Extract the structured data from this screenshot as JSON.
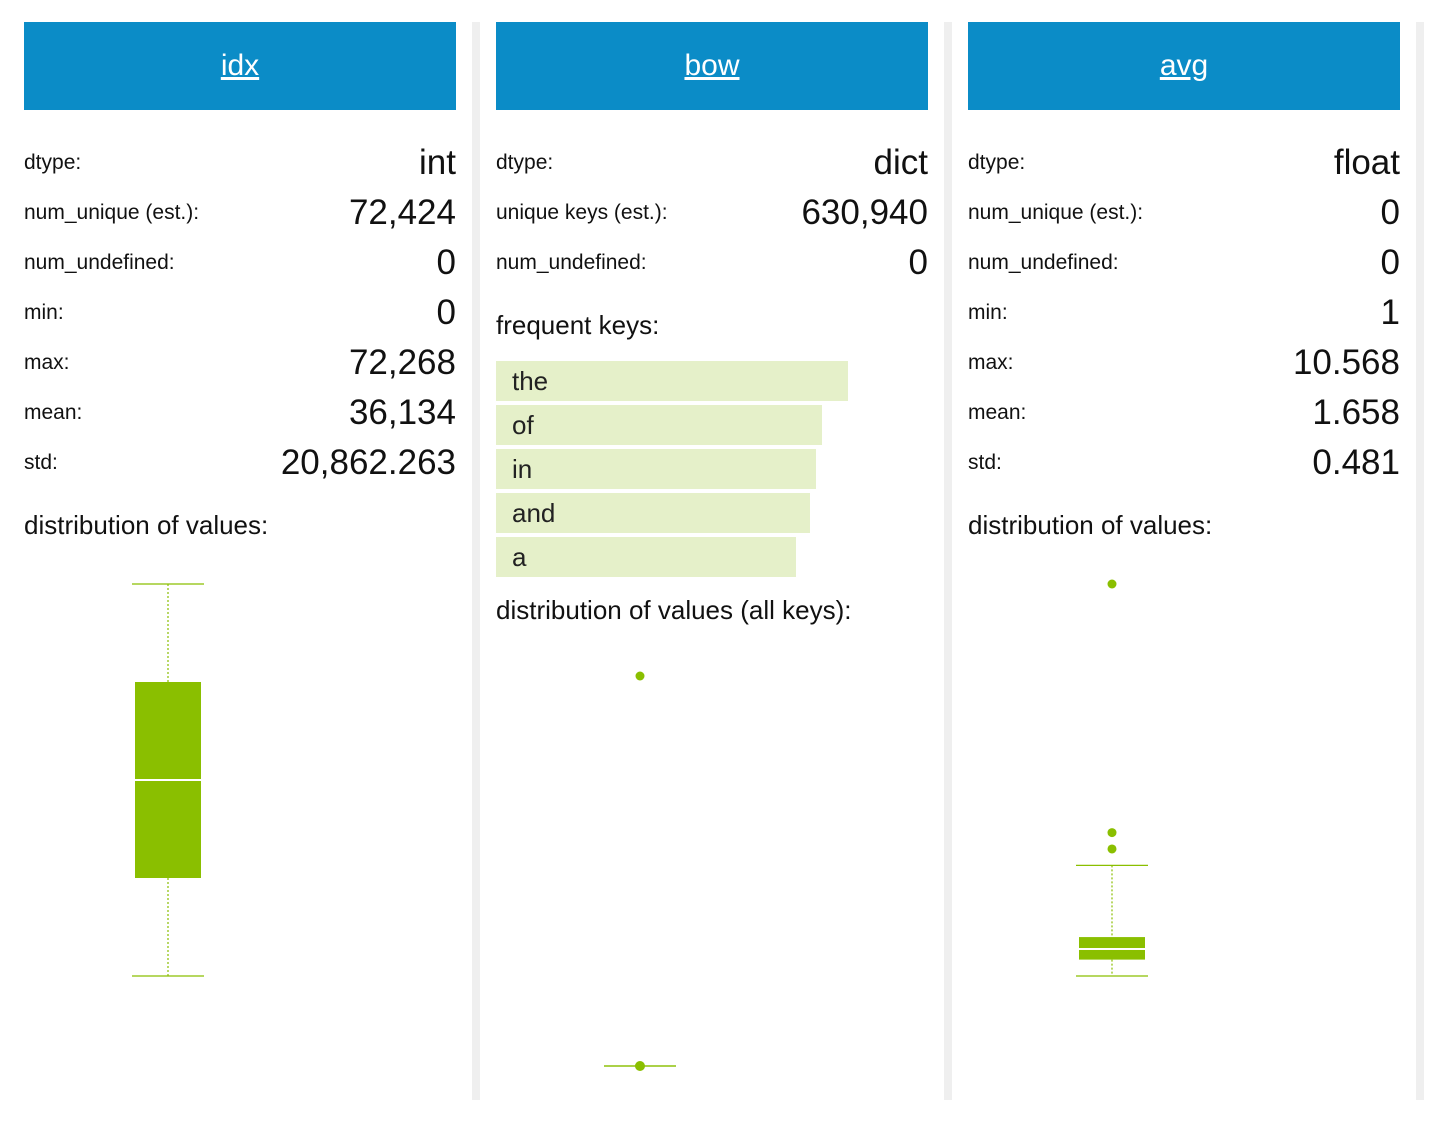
{
  "colors": {
    "header": "#0b8cc7",
    "accent": "#8abf00",
    "freq_bar": "#e5f0c9"
  },
  "columns": [
    {
      "header": "idx",
      "stats": [
        {
          "label": "dtype:",
          "value": "int"
        },
        {
          "label": "num_unique (est.):",
          "value": "72,424"
        },
        {
          "label": "num_undefined:",
          "value": "0"
        },
        {
          "label": "min:",
          "value": "0"
        },
        {
          "label": "max:",
          "value": "72,268"
        },
        {
          "label": "mean:",
          "value": "36,134"
        },
        {
          "label": "std:",
          "value": "20,862.263"
        }
      ],
      "distribution_title": "distribution of values:"
    },
    {
      "header": "bow",
      "stats": [
        {
          "label": "dtype:",
          "value": "dict"
        },
        {
          "label": "unique keys (est.):",
          "value": "630,940"
        },
        {
          "label": "num_undefined:",
          "value": "0"
        }
      ],
      "frequent_title": "frequent keys:",
      "frequent_keys": [
        "the",
        "of",
        "in",
        "and",
        "a"
      ],
      "distribution_title": "distribution of values (all keys):"
    },
    {
      "header": "avg",
      "stats": [
        {
          "label": "dtype:",
          "value": "float"
        },
        {
          "label": "num_unique (est.):",
          "value": "0"
        },
        {
          "label": "num_undefined:",
          "value": "0"
        },
        {
          "label": "min:",
          "value": "1"
        },
        {
          "label": "max:",
          "value": "10.568"
        },
        {
          "label": "mean:",
          "value": "1.658"
        },
        {
          "label": "std:",
          "value": "0.481"
        }
      ],
      "distribution_title": "distribution of values:"
    }
  ],
  "chart_data": [
    {
      "type": "box",
      "column": "idx",
      "ylim": [
        0,
        72268
      ],
      "whisker_low": 0,
      "q1": 18067,
      "median": 36134,
      "q3": 54201,
      "whisker_high": 72268,
      "outliers": []
    },
    {
      "type": "box",
      "column": "bow",
      "ylim": [
        0,
        1
      ],
      "whisker_low": 0,
      "q1": 0,
      "median": 0,
      "q3": 0,
      "whisker_high": 0,
      "outliers": [
        1
      ]
    },
    {
      "type": "box",
      "column": "avg",
      "ylim": [
        1,
        10.568
      ],
      "whisker_low": 1,
      "q1": 1.4,
      "median": 1.66,
      "q3": 1.95,
      "whisker_high": 3.7,
      "outliers": [
        4.1,
        4.5,
        10.568
      ]
    }
  ],
  "frequent_key_shares": [
    1,
    0.926,
    0.909,
    0.892,
    0.852
  ]
}
